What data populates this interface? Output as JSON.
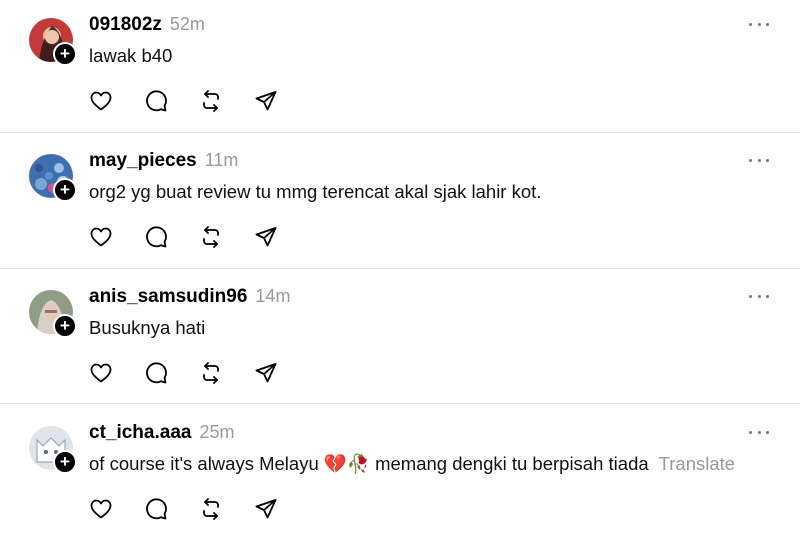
{
  "follow_badge_label": "+",
  "posts": [
    {
      "username": "091802z",
      "time": "52m",
      "text": "lawak b40",
      "translate_label": "",
      "avatar": {
        "bg": "#c23a3a",
        "fg": "#2a1a16"
      }
    },
    {
      "username": "may_pieces",
      "time": "11m",
      "text": "org2 yg buat review tu mmg terencat akal sjak lahir kot.",
      "translate_label": "",
      "avatar": {
        "bg": "#3f6fb0",
        "fg": "#b8d4ea"
      }
    },
    {
      "username": "anis_samsudin96",
      "time": "14m",
      "text": "Busuknya hati",
      "translate_label": "",
      "avatar": {
        "bg": "#8f9d86",
        "fg": "#d8d0c6"
      }
    },
    {
      "username": "ct_icha.aaa",
      "time": "25m",
      "text": "of course it's always Melayu 💔🥀 memang dengki tu berpisah tiada",
      "translate_label": "Translate",
      "avatar": {
        "bg": "#dfe3ea",
        "fg": "#9aa6bd"
      }
    }
  ],
  "icons": {
    "like": "heart-icon",
    "comment": "comment-icon",
    "repost": "repost-icon",
    "share": "send-icon",
    "more": "more-options-icon"
  }
}
